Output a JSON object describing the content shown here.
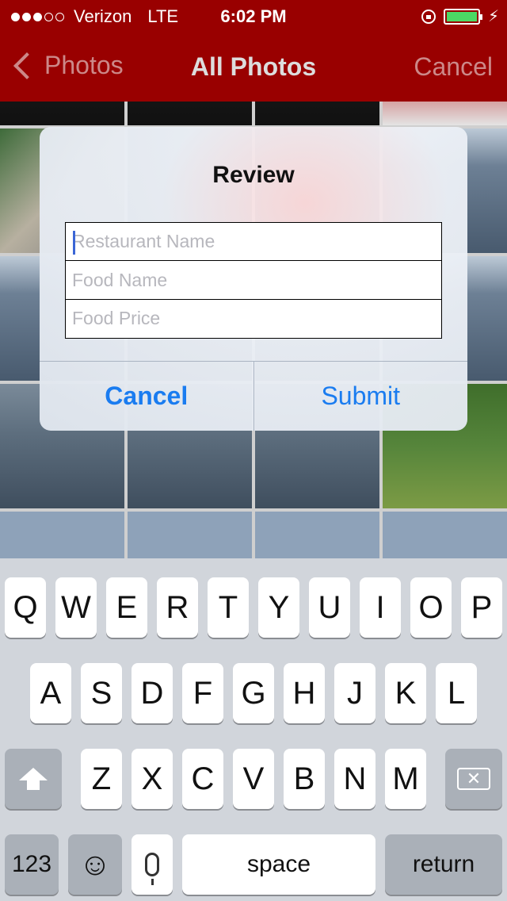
{
  "status_bar": {
    "carrier": "Verizon",
    "network": "LTE",
    "time": "6:02 PM",
    "signal_bars_filled": 3,
    "signal_bars_total": 5,
    "battery_fill": 1.0,
    "battery_color": "#4cd964"
  },
  "nav": {
    "back_label": "Photos",
    "title": "All Photos",
    "cancel_label": "Cancel",
    "bar_color": "#990000"
  },
  "dialog": {
    "title": "Review",
    "fields": [
      {
        "placeholder": "Restaurant Name",
        "value": ""
      },
      {
        "placeholder": "Food Name",
        "value": ""
      },
      {
        "placeholder": "Food Price",
        "value": ""
      }
    ],
    "cancel_label": "Cancel",
    "submit_label": "Submit",
    "accent_color": "#1a7cf0"
  },
  "keyboard": {
    "row1": [
      "Q",
      "W",
      "E",
      "R",
      "T",
      "Y",
      "U",
      "I",
      "O",
      "P"
    ],
    "row2": [
      "A",
      "S",
      "D",
      "F",
      "G",
      "H",
      "J",
      "K",
      "L"
    ],
    "row3": [
      "Z",
      "X",
      "C",
      "V",
      "B",
      "N",
      "M"
    ],
    "numbers_label": "123",
    "space_label": "space",
    "return_label": "return"
  }
}
